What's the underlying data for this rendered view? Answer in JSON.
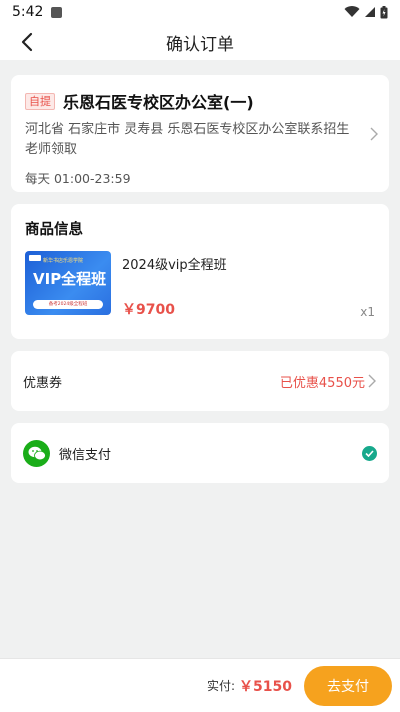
{
  "status_bar": {
    "time": "5:42"
  },
  "header": {
    "title": "确认订单"
  },
  "address": {
    "tag": "自提",
    "title": "乐恩石医专校区办公室(一)",
    "detail": "河北省 石家庄市 灵寿县 乐恩石医专校区办公室联系招生老师领取",
    "hours": "每天 01:00-23:59"
  },
  "goods": {
    "section_title": "商品信息",
    "thumb_text_top": "新华书店乐恩学院",
    "thumb_text_main": "VIP全程班",
    "thumb_text_bottom": "备考2024级全程班",
    "name": "2024级vip全程班",
    "price": "￥9700",
    "qty": "x1"
  },
  "coupon": {
    "label": "优惠券",
    "value": "已优惠4550元"
  },
  "payment": {
    "method": "微信支付"
  },
  "footer": {
    "total_label": "实付:",
    "total_value": "￥5150",
    "pay_button": "去支付"
  },
  "colors": {
    "accent": "#f6a21e",
    "price_red": "#e8514a",
    "wechat_green": "#1aad19",
    "check_teal": "#17a98c"
  }
}
